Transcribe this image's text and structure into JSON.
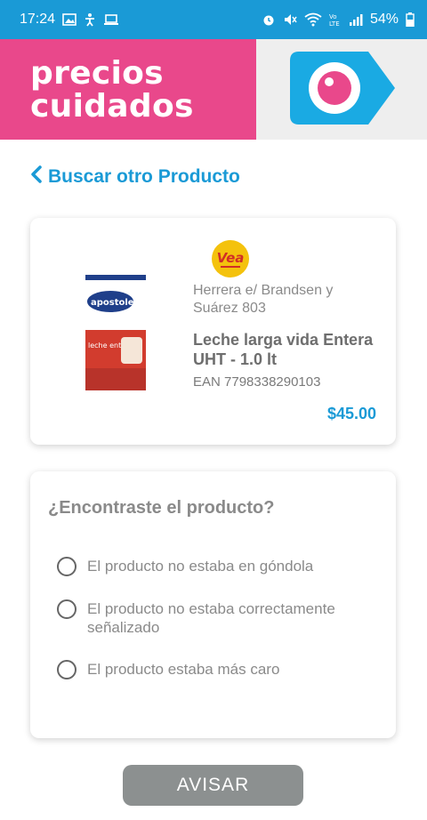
{
  "status_bar": {
    "time": "17:24",
    "battery": "54%",
    "bg_color": "#1a9ad6"
  },
  "header": {
    "brand_line1": "precios",
    "brand_line2": "cuidados",
    "brand_color": "#e9488b",
    "logo_icon": "eye-tag-icon"
  },
  "nav": {
    "back_label": "Buscar otro Producto"
  },
  "product": {
    "store_logo_text": "Vea",
    "image_brand_text": "apostoles",
    "image_product_text": "leche entera",
    "store_address": "Herrera  e/ Brandsen y Suárez 803",
    "name": "Leche larga vida Entera UHT - 1.0 lt",
    "ean": "EAN 7798338290103",
    "price": "$45.00"
  },
  "question": {
    "title": "¿Encontraste el producto?",
    "options": [
      {
        "label": "El producto no estaba en góndola"
      },
      {
        "label": "El producto no estaba correctamente señalizado"
      },
      {
        "label": "El producto estaba más caro"
      }
    ]
  },
  "actions": {
    "submit_label": "AVISAR"
  }
}
